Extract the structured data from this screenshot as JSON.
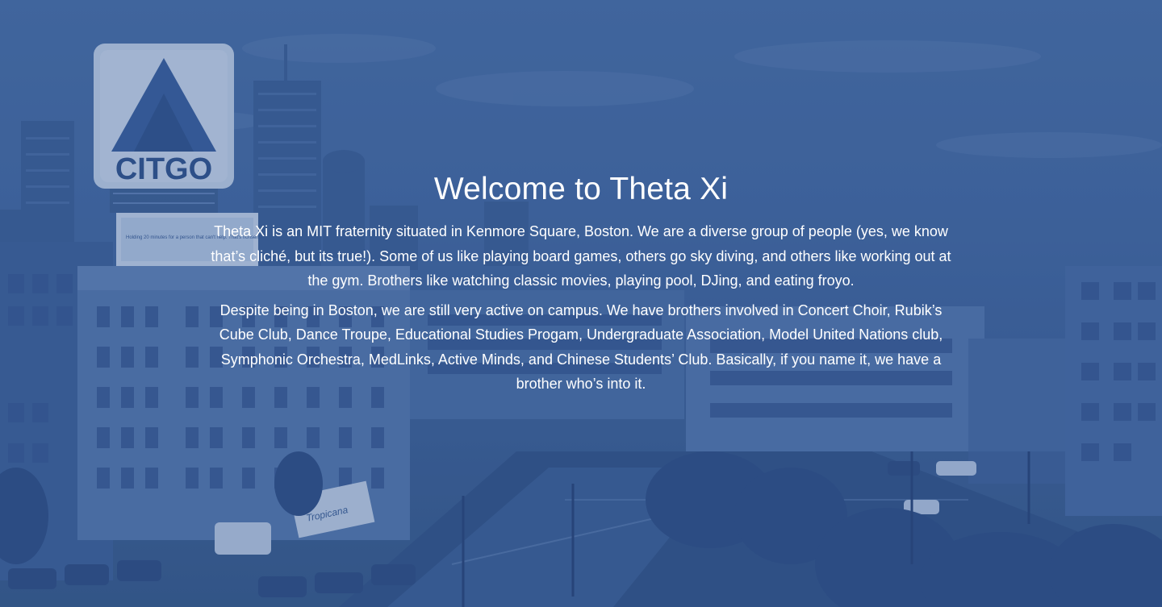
{
  "hero": {
    "title": "Welcome to Theta Xi",
    "paragraphs": [
      "Theta Xi is an MIT fraternity situated in Kenmore Square, Boston. We are a diverse group of people (yes, we know that’s cliché, but its true!). Some of us like playing board games, others go sky diving, and others like working out at the gym. Brothers like watching classic movies, playing pool, DJing, and eating froyo.",
      "Despite being in Boston, we are still very active on campus. We have brothers involved in Concert Choir, Rubik’s Cube Club, Dance Troupe, Educational Studies Progam, Undergraduate Association, Model United Nations club, Symphonic Orchestra, MedLinks, Active Minds, and Chinese Students’ Club. Basically, if you name it, we have a brother who’s into it."
    ]
  },
  "background": {
    "sign_text": "CITGO",
    "billboard_text": "Holding 20 minutes for a person that can't help. That's nonsense.",
    "truck_text": "Tropicana",
    "tint": "#3f6299"
  }
}
